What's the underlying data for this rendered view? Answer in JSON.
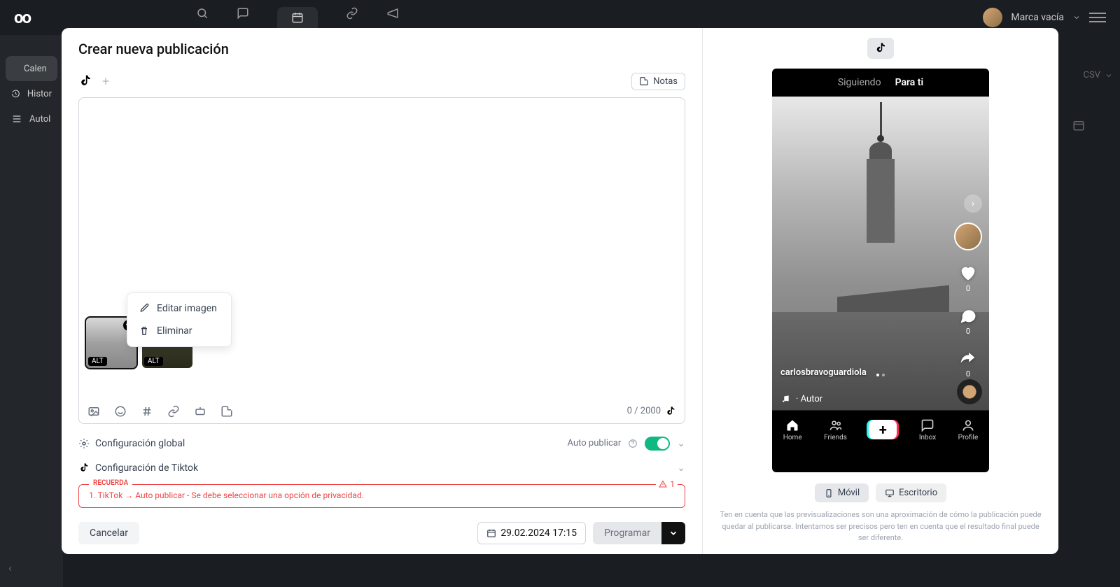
{
  "bg": {
    "logo": "oo",
    "brand": "Marca vacía",
    "sidebar": {
      "cal": "Calen",
      "hist": "Histor",
      "auto": "Autol"
    },
    "csv": "CSV"
  },
  "modal": {
    "title": "Crear nueva publicación",
    "notes": "Notas",
    "context": {
      "edit": "Editar imagen",
      "delete": "Eliminar"
    },
    "alt": "ALT",
    "counter": "0 / 2000",
    "config": {
      "global": "Configuración global",
      "autopub": "Auto publicar",
      "tiktok": "Configuración de Tiktok"
    },
    "warning": {
      "label": "RECUERDA",
      "text": "1. TikTok → Auto publicar - Se debe seleccionar una opción de privacidad.",
      "count": "1"
    },
    "footer": {
      "cancel": "Cancelar",
      "date": "29.02.2024 17:15",
      "schedule": "Programar"
    }
  },
  "preview": {
    "tabs": {
      "following": "Siguiendo",
      "foryou": "Para ti"
    },
    "side": {
      "like": "0",
      "comment": "0",
      "share": "0"
    },
    "username": "carlosbravoguardiola",
    "author": "· Autor",
    "nav": {
      "home": "Home",
      "friends": "Friends",
      "inbox": "Inbox",
      "profile": "Profile"
    },
    "toggle": {
      "mobile": "Móvil",
      "desktop": "Escritorio"
    },
    "disclaimer": "Ten en cuenta que las previsualizaciones son una aproximación de cómo la publicación puede quedar al publicarse. Intentamos ser precisos pero ten en cuenta que el resultado final puede ser diferente."
  }
}
